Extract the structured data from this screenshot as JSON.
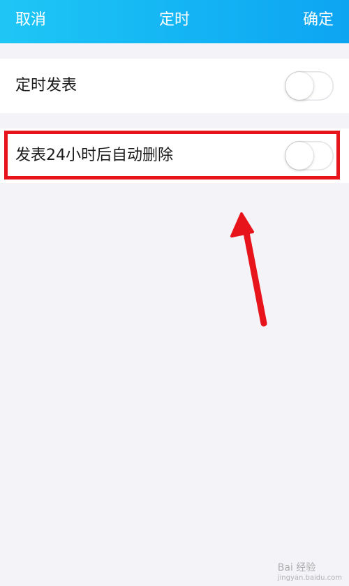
{
  "header": {
    "cancel_label": "取消",
    "title": "定时",
    "confirm_label": "确定"
  },
  "settings": [
    {
      "label": "定时发表",
      "enabled": false
    },
    {
      "label": "发表24小时后自动删除",
      "enabled": false
    }
  ],
  "annotation": {
    "highlight_color": "#e8141b"
  },
  "watermark": {
    "text": "Bai 经验",
    "sub": "jingyan.baidu.com"
  }
}
